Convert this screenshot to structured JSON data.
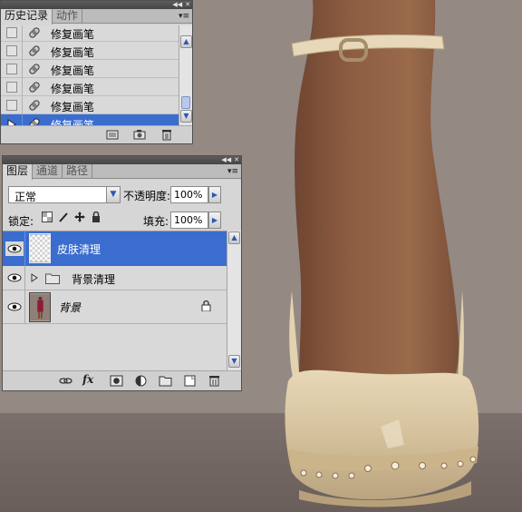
{
  "history_panel": {
    "tabs": [
      "历史记录",
      "动作"
    ],
    "active_tab": "历史记录",
    "menu_icon": "panel-menu-icon",
    "items": [
      {
        "label": "修复画笔",
        "icon": "healing-brush-icon",
        "selected": false
      },
      {
        "label": "修复画笔",
        "icon": "healing-brush-icon",
        "selected": false
      },
      {
        "label": "修复画笔",
        "icon": "healing-brush-icon",
        "selected": false
      },
      {
        "label": "修复画笔",
        "icon": "healing-brush-icon",
        "selected": false
      },
      {
        "label": "修复画笔",
        "icon": "healing-brush-icon",
        "selected": true
      }
    ],
    "footer_icons": [
      "new-document-from-state-icon",
      "snapshot-camera-icon",
      "trash-icon"
    ]
  },
  "layers_panel": {
    "tabs": [
      "图层",
      "通道",
      "路径"
    ],
    "active_tab": "图层",
    "blend_mode": "正常",
    "opacity_label": "不透明度:",
    "opacity_value": "100%",
    "lock_label": "锁定:",
    "lock_icons": [
      "lock-transparency-icon",
      "lock-paint-icon",
      "lock-move-icon",
      "lock-all-icon"
    ],
    "fill_label": "填充:",
    "fill_value": "100%",
    "layers": [
      {
        "name": "皮肤清理",
        "type": "layer",
        "thumbnail": "transparent",
        "visible": true,
        "selected": true,
        "locked": false
      },
      {
        "name": "背景清理",
        "type": "group",
        "visible": true,
        "selected": false,
        "locked": false
      },
      {
        "name": "背景",
        "type": "layer",
        "thumbnail": "photo",
        "visible": true,
        "selected": false,
        "locked": true
      }
    ],
    "footer_icons": [
      "link-layers-icon",
      "fx-icon",
      "add-mask-icon",
      "adjustment-layer-icon",
      "new-group-icon",
      "new-layer-icon",
      "trash-icon"
    ]
  },
  "colors": {
    "selection": "#3b6dcf",
    "panel_bg": "#d6d6d6",
    "titlebar": "#4f4f4f",
    "photo_bg": "#948883",
    "skin": "#8a5a40",
    "shoe": "#d9c7a4"
  }
}
